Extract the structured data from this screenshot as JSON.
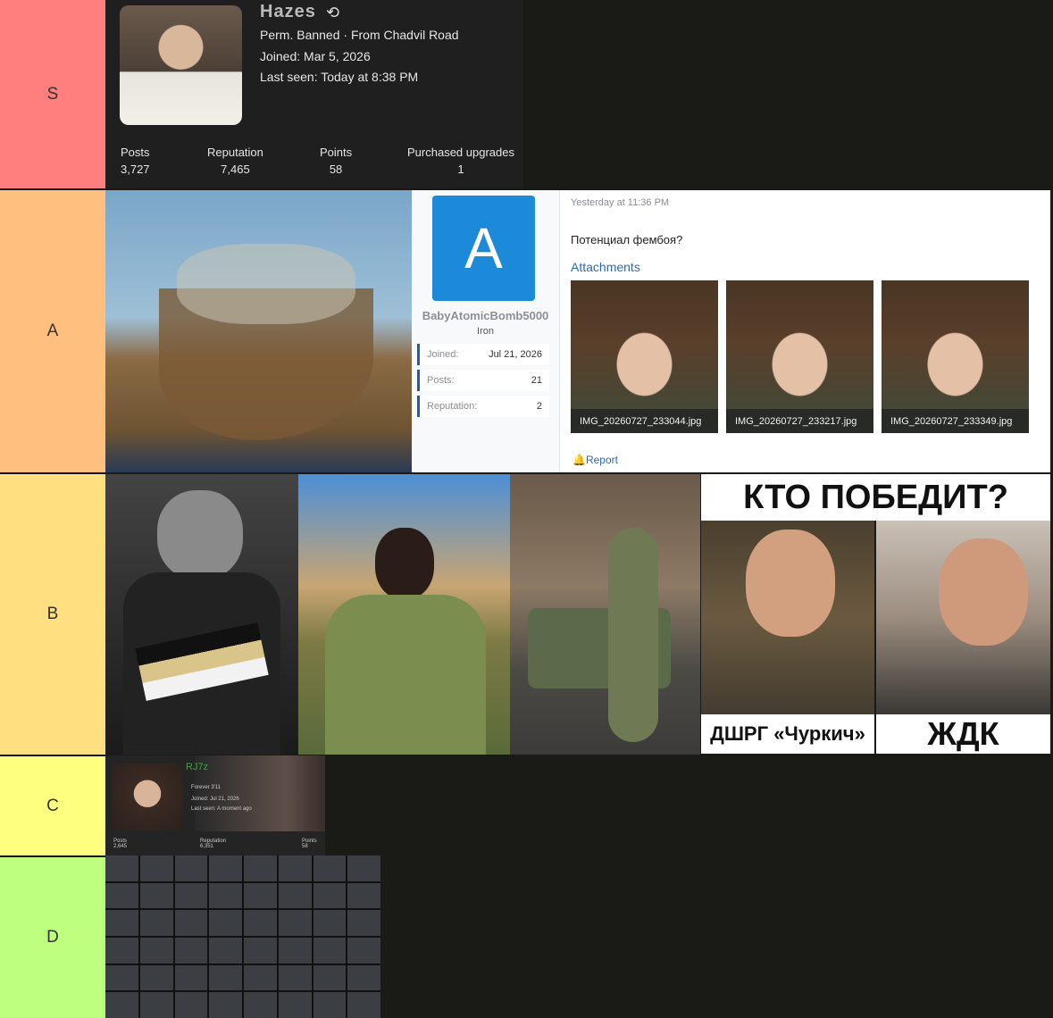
{
  "tiers": [
    {
      "label": "S",
      "color": "#ff7f7f"
    },
    {
      "label": "A",
      "color": "#ffbf7f"
    },
    {
      "label": "B",
      "color": "#ffdf7f"
    },
    {
      "label": "C",
      "color": "#ffff7f"
    },
    {
      "label": "D",
      "color": "#bfff7f"
    }
  ],
  "s_profile": {
    "username": "Hazes",
    "history_icon": "history-icon",
    "line1": "Perm. Banned · From Chadvil Road",
    "joined": "Joined: Mar 5, 2026",
    "last_seen": "Last seen: Today at 8:38 PM",
    "stats": [
      {
        "label": "Posts",
        "value": "3,727"
      },
      {
        "label": "Reputation",
        "value": "7,465"
      },
      {
        "label": "Points",
        "value": "58"
      },
      {
        "label": "Purchased upgrades",
        "value": "1"
      }
    ]
  },
  "a_post": {
    "avatar_letter": "A",
    "username": "BabyAtomicBomb5000",
    "rank": "Iron",
    "info": [
      {
        "label": "Joined:",
        "value": "Jul 21, 2026"
      },
      {
        "label": "Posts:",
        "value": "21"
      },
      {
        "label": "Reputation:",
        "value": "2"
      }
    ],
    "time": "Yesterday at 11:36 PM",
    "text": "Потенциал фембоя?",
    "attachments_label": "Attachments",
    "attachments": [
      "IMG_20260727_233044.jpg",
      "IMG_20260727_233217.jpg",
      "IMG_20260727_233349.jpg"
    ],
    "report": "Report"
  },
  "b_meme": {
    "title": "КТО ПОБЕДИТ?",
    "left_caption": "ДШРГ «Чуркич»",
    "right_caption": "ЖДК"
  },
  "c_profile": {
    "username": "RJ7z",
    "line1": "Forever 3'11",
    "joined": "Joined: Jul 21, 2026",
    "last_seen": "Last seen: A moment ago",
    "stats": [
      {
        "label": "Posts",
        "value": "2,645"
      },
      {
        "label": "Reputation",
        "value": "6,351"
      },
      {
        "label": "Points",
        "value": "58"
      }
    ]
  }
}
